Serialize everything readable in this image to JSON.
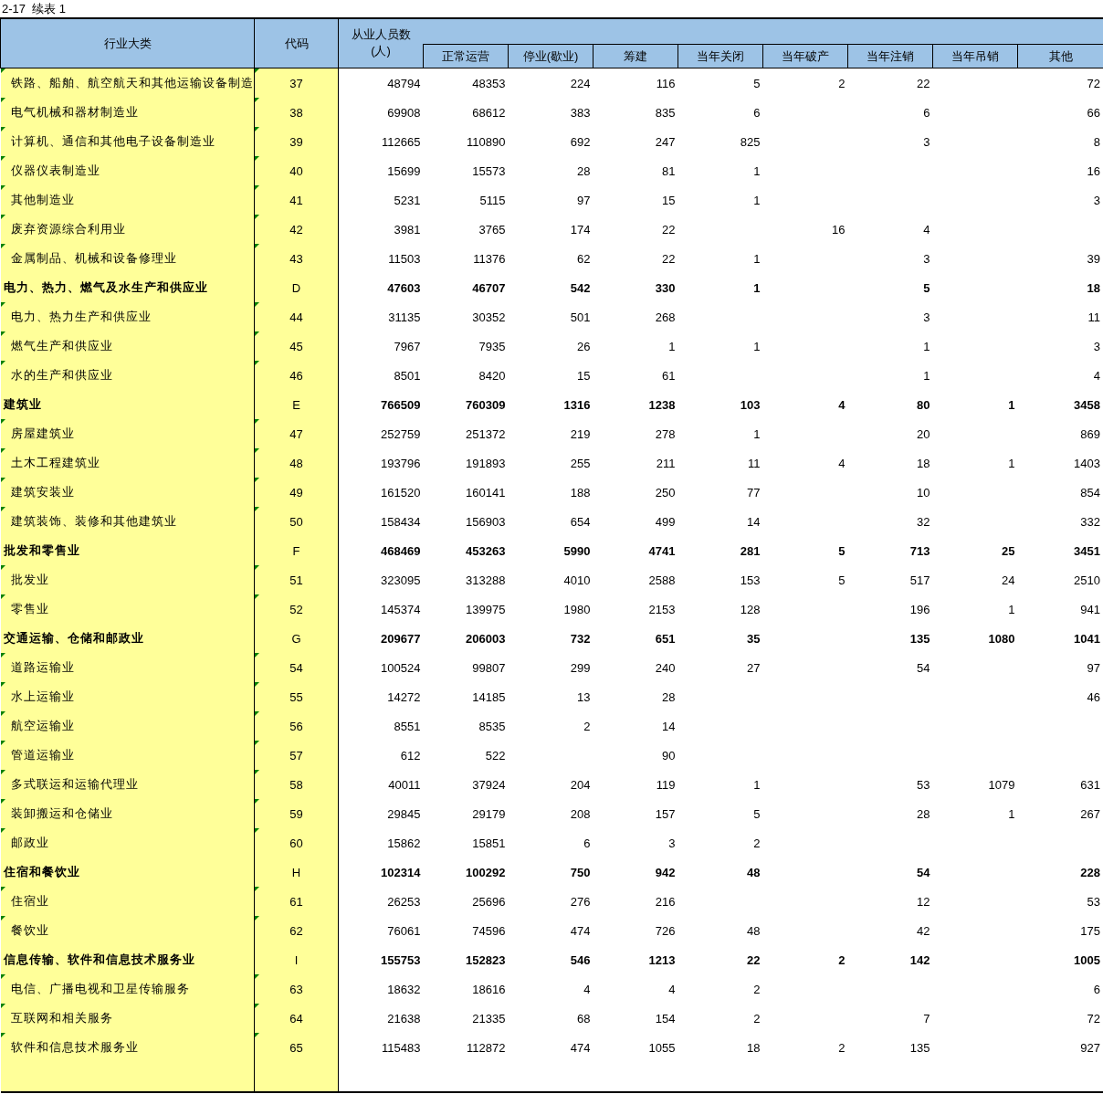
{
  "title": "2-17  续表 1",
  "columns": {
    "industry": "行业大类",
    "code": "代码",
    "total": "从业人员数\n(人)",
    "operating": "正常运营",
    "suspended": "停业(歇业)",
    "preparing": "筹建",
    "closed": "当年关闭",
    "bankrupt": "当年破产",
    "deregistered": "当年注销",
    "revoked": "当年吊销",
    "other": "其他"
  },
  "rows": [
    {
      "kind": "item",
      "name": "铁路、船舶、航空航天和其他运输设备制造",
      "code": "37",
      "total": "48794",
      "operating": "48353",
      "suspended": "224",
      "preparing": "116",
      "closed": "5",
      "bankrupt": "2",
      "deregistered": "22",
      "other": "72"
    },
    {
      "kind": "item",
      "name": "电气机械和器材制造业",
      "code": "38",
      "total": "69908",
      "operating": "68612",
      "suspended": "383",
      "preparing": "835",
      "closed": "6",
      "deregistered": "6",
      "other": "66"
    },
    {
      "kind": "item",
      "name": "计算机、通信和其他电子设备制造业",
      "code": "39",
      "total": "112665",
      "operating": "110890",
      "suspended": "692",
      "preparing": "247",
      "closed": "825",
      "deregistered": "3",
      "other": "8"
    },
    {
      "kind": "item",
      "name": "仪器仪表制造业",
      "code": "40",
      "total": "15699",
      "operating": "15573",
      "suspended": "28",
      "preparing": "81",
      "closed": "1",
      "other": "16"
    },
    {
      "kind": "item",
      "name": "其他制造业",
      "code": "41",
      "total": "5231",
      "operating": "5115",
      "suspended": "97",
      "preparing": "15",
      "closed": "1",
      "other": "3"
    },
    {
      "kind": "item",
      "name": "废弃资源综合利用业",
      "code": "42",
      "total": "3981",
      "operating": "3765",
      "suspended": "174",
      "preparing": "22",
      "bankrupt": "16",
      "deregistered": "4"
    },
    {
      "kind": "item",
      "name": "金属制品、机械和设备修理业",
      "code": "43",
      "total": "11503",
      "operating": "11376",
      "suspended": "62",
      "preparing": "22",
      "closed": "1",
      "deregistered": "3",
      "other": "39"
    },
    {
      "kind": "section",
      "name": "电力、热力、燃气及水生产和供应业",
      "code": "D",
      "total": "47603",
      "operating": "46707",
      "suspended": "542",
      "preparing": "330",
      "closed": "1",
      "deregistered": "5",
      "other": "18"
    },
    {
      "kind": "item",
      "name": "电力、热力生产和供应业",
      "code": "44",
      "total": "31135",
      "operating": "30352",
      "suspended": "501",
      "preparing": "268",
      "deregistered": "3",
      "other": "11"
    },
    {
      "kind": "item",
      "name": "燃气生产和供应业",
      "code": "45",
      "total": "7967",
      "operating": "7935",
      "suspended": "26",
      "preparing": "1",
      "closed": "1",
      "deregistered": "1",
      "other": "3"
    },
    {
      "kind": "item",
      "name": "水的生产和供应业",
      "code": "46",
      "total": "8501",
      "operating": "8420",
      "suspended": "15",
      "preparing": "61",
      "deregistered": "1",
      "other": "4"
    },
    {
      "kind": "section",
      "name": "建筑业",
      "code": "E",
      "total": "766509",
      "operating": "760309",
      "suspended": "1316",
      "preparing": "1238",
      "closed": "103",
      "bankrupt": "4",
      "deregistered": "80",
      "revoked": "1",
      "other": "3458"
    },
    {
      "kind": "item",
      "name": "房屋建筑业",
      "code": "47",
      "total": "252759",
      "operating": "251372",
      "suspended": "219",
      "preparing": "278",
      "closed": "1",
      "deregistered": "20",
      "other": "869"
    },
    {
      "kind": "item",
      "name": "土木工程建筑业",
      "code": "48",
      "total": "193796",
      "operating": "191893",
      "suspended": "255",
      "preparing": "211",
      "closed": "11",
      "bankrupt": "4",
      "deregistered": "18",
      "revoked": "1",
      "other": "1403"
    },
    {
      "kind": "item",
      "name": "建筑安装业",
      "code": "49",
      "total": "161520",
      "operating": "160141",
      "suspended": "188",
      "preparing": "250",
      "closed": "77",
      "deregistered": "10",
      "other": "854"
    },
    {
      "kind": "item",
      "name": "建筑装饰、装修和其他建筑业",
      "code": "50",
      "total": "158434",
      "operating": "156903",
      "suspended": "654",
      "preparing": "499",
      "closed": "14",
      "deregistered": "32",
      "other": "332"
    },
    {
      "kind": "section",
      "name": "批发和零售业",
      "code": "F",
      "total": "468469",
      "operating": "453263",
      "suspended": "5990",
      "preparing": "4741",
      "closed": "281",
      "bankrupt": "5",
      "deregistered": "713",
      "revoked": "25",
      "other": "3451"
    },
    {
      "kind": "item",
      "name": "批发业",
      "code": "51",
      "total": "323095",
      "operating": "313288",
      "suspended": "4010",
      "preparing": "2588",
      "closed": "153",
      "bankrupt": "5",
      "deregistered": "517",
      "revoked": "24",
      "other": "2510"
    },
    {
      "kind": "item",
      "name": "零售业",
      "code": "52",
      "total": "145374",
      "operating": "139975",
      "suspended": "1980",
      "preparing": "2153",
      "closed": "128",
      "deregistered": "196",
      "revoked": "1",
      "other": "941"
    },
    {
      "kind": "section",
      "name": "交通运输、仓储和邮政业",
      "code": "G",
      "total": "209677",
      "operating": "206003",
      "suspended": "732",
      "preparing": "651",
      "closed": "35",
      "deregistered": "135",
      "revoked": "1080",
      "other": "1041"
    },
    {
      "kind": "item",
      "name": "道路运输业",
      "code": "54",
      "total": "100524",
      "operating": "99807",
      "suspended": "299",
      "preparing": "240",
      "closed": "27",
      "deregistered": "54",
      "other": "97"
    },
    {
      "kind": "item",
      "name": "水上运输业",
      "code": "55",
      "total": "14272",
      "operating": "14185",
      "suspended": "13",
      "preparing": "28",
      "other": "46"
    },
    {
      "kind": "item",
      "name": "航空运输业",
      "code": "56",
      "total": "8551",
      "operating": "8535",
      "suspended": "2",
      "preparing": "14"
    },
    {
      "kind": "item",
      "name": "管道运输业",
      "code": "57",
      "total": "612",
      "operating": "522",
      "preparing": "90"
    },
    {
      "kind": "item",
      "name": "多式联运和运输代理业",
      "code": "58",
      "total": "40011",
      "operating": "37924",
      "suspended": "204",
      "preparing": "119",
      "closed": "1",
      "deregistered": "53",
      "revoked": "1079",
      "other": "631"
    },
    {
      "kind": "item",
      "name": "装卸搬运和仓储业",
      "code": "59",
      "total": "29845",
      "operating": "29179",
      "suspended": "208",
      "preparing": "157",
      "closed": "5",
      "deregistered": "28",
      "revoked": "1",
      "other": "267"
    },
    {
      "kind": "item",
      "name": "邮政业",
      "code": "60",
      "total": "15862",
      "operating": "15851",
      "suspended": "6",
      "preparing": "3",
      "closed": "2"
    },
    {
      "kind": "section",
      "name": "住宿和餐饮业",
      "code": "H",
      "total": "102314",
      "operating": "100292",
      "suspended": "750",
      "preparing": "942",
      "closed": "48",
      "deregistered": "54",
      "other": "228"
    },
    {
      "kind": "item",
      "name": "住宿业",
      "code": "61",
      "total": "26253",
      "operating": "25696",
      "suspended": "276",
      "preparing": "216",
      "deregistered": "12",
      "other": "53"
    },
    {
      "kind": "item",
      "name": "餐饮业",
      "code": "62",
      "total": "76061",
      "operating": "74596",
      "suspended": "474",
      "preparing": "726",
      "closed": "48",
      "deregistered": "42",
      "other": "175"
    },
    {
      "kind": "section",
      "name": "信息传输、软件和信息技术服务业",
      "code": "I",
      "total": "155753",
      "operating": "152823",
      "suspended": "546",
      "preparing": "1213",
      "closed": "22",
      "bankrupt": "2",
      "deregistered": "142",
      "other": "1005"
    },
    {
      "kind": "item",
      "name": "电信、广播电视和卫星传输服务",
      "code": "63",
      "total": "18632",
      "operating": "18616",
      "suspended": "4",
      "preparing": "4",
      "closed": "2",
      "other": "6"
    },
    {
      "kind": "item",
      "name": "互联网和相关服务",
      "code": "64",
      "total": "21638",
      "operating": "21335",
      "suspended": "68",
      "preparing": "154",
      "closed": "2",
      "deregistered": "7",
      "other": "72"
    },
    {
      "kind": "item",
      "name": "软件和信息技术服务业",
      "code": "65",
      "total": "115483",
      "operating": "112872",
      "suspended": "474",
      "preparing": "1055",
      "closed": "18",
      "bankrupt": "2",
      "deregistered": "135",
      "other": "927"
    }
  ]
}
